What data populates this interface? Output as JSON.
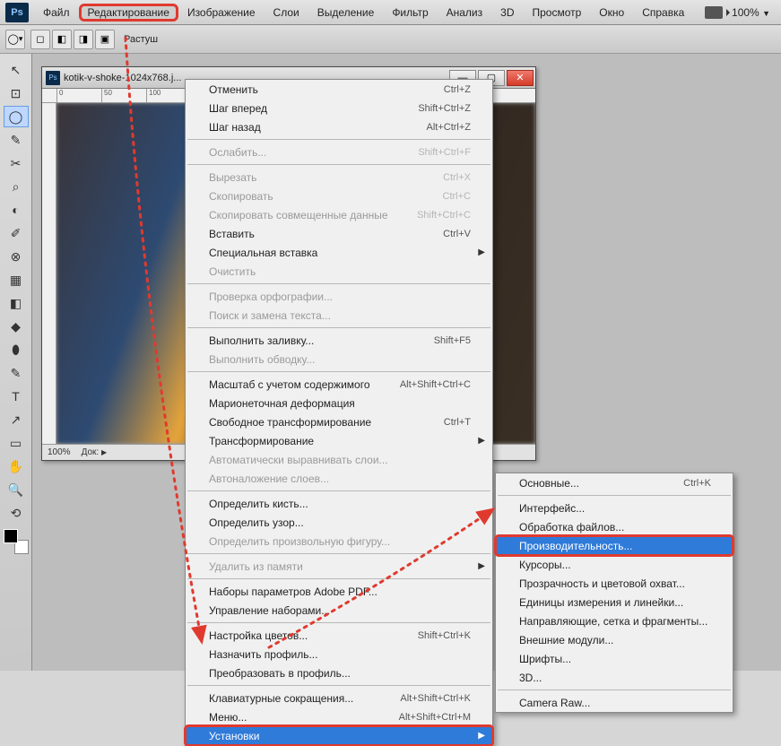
{
  "menubar": {
    "items": [
      "Файл",
      "Редактирование",
      "Изображение",
      "Слои",
      "Выделение",
      "Фильтр",
      "Анализ",
      "3D",
      "Просмотр",
      "Окно",
      "Справка"
    ],
    "zoom": "100%"
  },
  "optionsbar": {
    "feather_label": "Растуш"
  },
  "document": {
    "title": "kotik-v-shoke-1024x768.j...",
    "zoom": "100%",
    "docsize_label": "Док:",
    "ruler_marks": [
      "0",
      "50",
      "100"
    ]
  },
  "editmenu": [
    {
      "label": "Отменить",
      "shortcut": "Ctrl+Z",
      "enabled": true
    },
    {
      "label": "Шаг вперед",
      "shortcut": "Shift+Ctrl+Z",
      "enabled": true
    },
    {
      "label": "Шаг назад",
      "shortcut": "Alt+Ctrl+Z",
      "enabled": true
    },
    {
      "sep": true
    },
    {
      "label": "Ослабить...",
      "shortcut": "Shift+Ctrl+F",
      "enabled": false
    },
    {
      "sep": true
    },
    {
      "label": "Вырезать",
      "shortcut": "Ctrl+X",
      "enabled": false
    },
    {
      "label": "Скопировать",
      "shortcut": "Ctrl+C",
      "enabled": false
    },
    {
      "label": "Скопировать совмещенные данные",
      "shortcut": "Shift+Ctrl+C",
      "enabled": false
    },
    {
      "label": "Вставить",
      "shortcut": "Ctrl+V",
      "enabled": true
    },
    {
      "label": "Специальная вставка",
      "submenu": true,
      "enabled": true
    },
    {
      "label": "Очистить",
      "enabled": false
    },
    {
      "sep": true
    },
    {
      "label": "Проверка орфографии...",
      "enabled": false
    },
    {
      "label": "Поиск и замена текста...",
      "enabled": false
    },
    {
      "sep": true
    },
    {
      "label": "Выполнить заливку...",
      "shortcut": "Shift+F5",
      "enabled": true
    },
    {
      "label": "Выполнить обводку...",
      "enabled": false
    },
    {
      "sep": true
    },
    {
      "label": "Масштаб с учетом содержимого",
      "shortcut": "Alt+Shift+Ctrl+C",
      "enabled": true
    },
    {
      "label": "Марионеточная деформация",
      "enabled": true
    },
    {
      "label": "Свободное трансформирование",
      "shortcut": "Ctrl+T",
      "enabled": true
    },
    {
      "label": "Трансформирование",
      "submenu": true,
      "enabled": true
    },
    {
      "label": "Автоматически выравнивать слои...",
      "enabled": false
    },
    {
      "label": "Автоналожение слоев...",
      "enabled": false
    },
    {
      "sep": true
    },
    {
      "label": "Определить кисть...",
      "enabled": true
    },
    {
      "label": "Определить узор...",
      "enabled": true
    },
    {
      "label": "Определить произвольную фигуру...",
      "enabled": false
    },
    {
      "sep": true
    },
    {
      "label": "Удалить из памяти",
      "submenu": true,
      "enabled": false
    },
    {
      "sep": true
    },
    {
      "label": "Наборы параметров Adobe PDF...",
      "enabled": true
    },
    {
      "label": "Управление наборами...",
      "enabled": true
    },
    {
      "sep": true
    },
    {
      "label": "Настройка цветов...",
      "shortcut": "Shift+Ctrl+K",
      "enabled": true
    },
    {
      "label": "Назначить профиль...",
      "enabled": true
    },
    {
      "label": "Преобразовать в профиль...",
      "enabled": true
    },
    {
      "sep": true
    },
    {
      "label": "Клавиатурные сокращения...",
      "shortcut": "Alt+Shift+Ctrl+K",
      "enabled": true
    },
    {
      "label": "Меню...",
      "shortcut": "Alt+Shift+Ctrl+M",
      "enabled": true
    },
    {
      "label": "Установки",
      "submenu": true,
      "enabled": true,
      "highlight": true,
      "redbox": true
    }
  ],
  "submenu": [
    {
      "label": "Основные...",
      "shortcut": "Ctrl+K"
    },
    {
      "sep": true
    },
    {
      "label": "Интерфейс..."
    },
    {
      "label": "Обработка файлов..."
    },
    {
      "label": "Производительность...",
      "highlight": true,
      "redbox": true
    },
    {
      "label": "Курсоры..."
    },
    {
      "label": "Прозрачность и цветовой охват..."
    },
    {
      "label": "Единицы измерения и линейки..."
    },
    {
      "label": "Направляющие, сетка и фрагменты..."
    },
    {
      "label": "Внешние модули..."
    },
    {
      "label": "Шрифты..."
    },
    {
      "label": "3D..."
    },
    {
      "sep": true
    },
    {
      "label": "Camera Raw..."
    }
  ],
  "tools": [
    "↖",
    "⊡",
    "◯",
    "✎",
    "✂",
    "⌕",
    "◐",
    "✐",
    "⊗",
    "▦",
    "◧",
    "◆",
    "⬮",
    "✎",
    "T",
    "↗",
    "▭",
    "✋",
    "🔍",
    "⟲"
  ]
}
